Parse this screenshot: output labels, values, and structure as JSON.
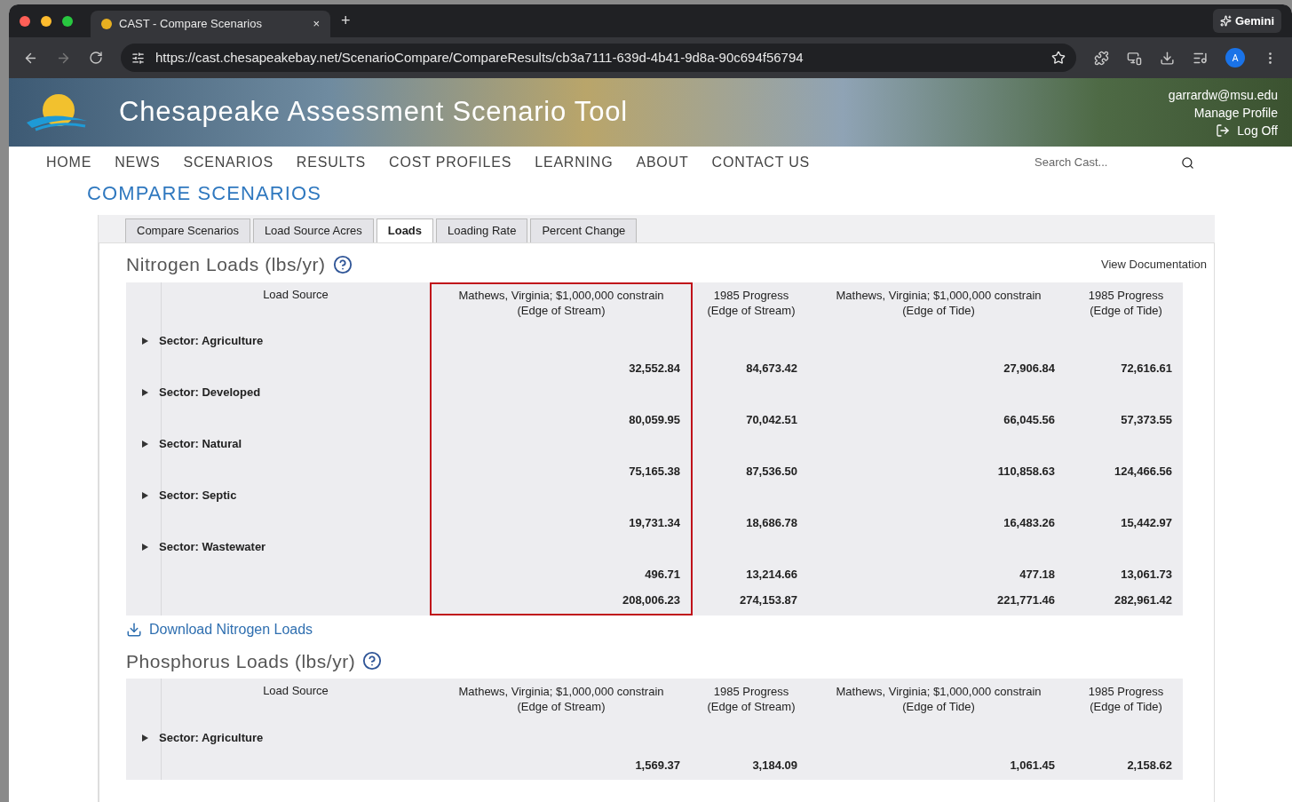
{
  "browser": {
    "tab_title": "CAST - Compare Scenarios",
    "tab_close": "×",
    "new_tab": "+",
    "gemini": "Gemini",
    "url": "https://cast.chesapeakebay.net/ScenarioCompare/CompareResults/cb3a7111-639d-4b41-9d8a-90c694f56794",
    "profile_initial": "A"
  },
  "header": {
    "title": "Chesapeake Assessment Scenario Tool",
    "user": "garrardw@msu.edu",
    "manage_profile": "Manage Profile",
    "log_off": "Log Off"
  },
  "nav": {
    "items": [
      "HOME",
      "NEWS",
      "SCENARIOS",
      "RESULTS",
      "COST PROFILES",
      "LEARNING",
      "ABOUT",
      "CONTACT US"
    ],
    "search_placeholder": "Search Cast..."
  },
  "page_title": "COMPARE SCENARIOS",
  "tabs": [
    {
      "label": "Compare Scenarios",
      "selected": false
    },
    {
      "label": "Load Source Acres",
      "selected": false
    },
    {
      "label": "Loads",
      "selected": true
    },
    {
      "label": "Loading Rate",
      "selected": false
    },
    {
      "label": "Percent Change",
      "selected": false
    }
  ],
  "view_documentation": "View Documentation",
  "sections": [
    {
      "title": "Nitrogen Loads (lbs/yr)",
      "label_header": "Load Source",
      "columns": [
        {
          "name": "Mathews, Virginia; $1,000,000 constrain",
          "sub": "(Edge of Stream)",
          "highlighted": true
        },
        {
          "name": "1985 Progress",
          "sub": "(Edge of Stream)",
          "highlighted": false
        },
        {
          "name": "Mathews, Virginia; $1,000,000 constrain",
          "sub": "(Edge of Tide)",
          "highlighted": false
        },
        {
          "name": "1985 Progress",
          "sub": "(Edge of Tide)",
          "highlighted": false
        }
      ],
      "sectors": [
        {
          "label": "Sector: Agriculture",
          "values": [
            "32,552.84",
            "84,673.42",
            "27,906.84",
            "72,616.61"
          ]
        },
        {
          "label": "Sector: Developed",
          "values": [
            "80,059.95",
            "70,042.51",
            "66,045.56",
            "57,373.55"
          ]
        },
        {
          "label": "Sector: Natural",
          "values": [
            "75,165.38",
            "87,536.50",
            "110,858.63",
            "124,466.56"
          ]
        },
        {
          "label": "Sector: Septic",
          "values": [
            "19,731.34",
            "18,686.78",
            "16,483.26",
            "15,442.97"
          ]
        },
        {
          "label": "Sector: Wastewater",
          "values": [
            "496.71",
            "13,214.66",
            "477.18",
            "13,061.73"
          ]
        }
      ],
      "totals": [
        "208,006.23",
        "274,153.87",
        "221,771.46",
        "282,961.42"
      ],
      "download": "Download Nitrogen Loads"
    },
    {
      "title": "Phosphorus Loads (lbs/yr)",
      "label_header": "Load Source",
      "columns": [
        {
          "name": "Mathews, Virginia; $1,000,000 constrain",
          "sub": "(Edge of Stream)",
          "highlighted": false
        },
        {
          "name": "1985 Progress",
          "sub": "(Edge of Stream)",
          "highlighted": false
        },
        {
          "name": "Mathews, Virginia; $1,000,000 constrain",
          "sub": "(Edge of Tide)",
          "highlighted": false
        },
        {
          "name": "1985 Progress",
          "sub": "(Edge of Tide)",
          "highlighted": false
        }
      ],
      "sectors": [
        {
          "label": "Sector: Agriculture",
          "values": [
            "1,569.37",
            "3,184.09",
            "1,061.45",
            "2,158.62"
          ]
        }
      ]
    }
  ]
}
